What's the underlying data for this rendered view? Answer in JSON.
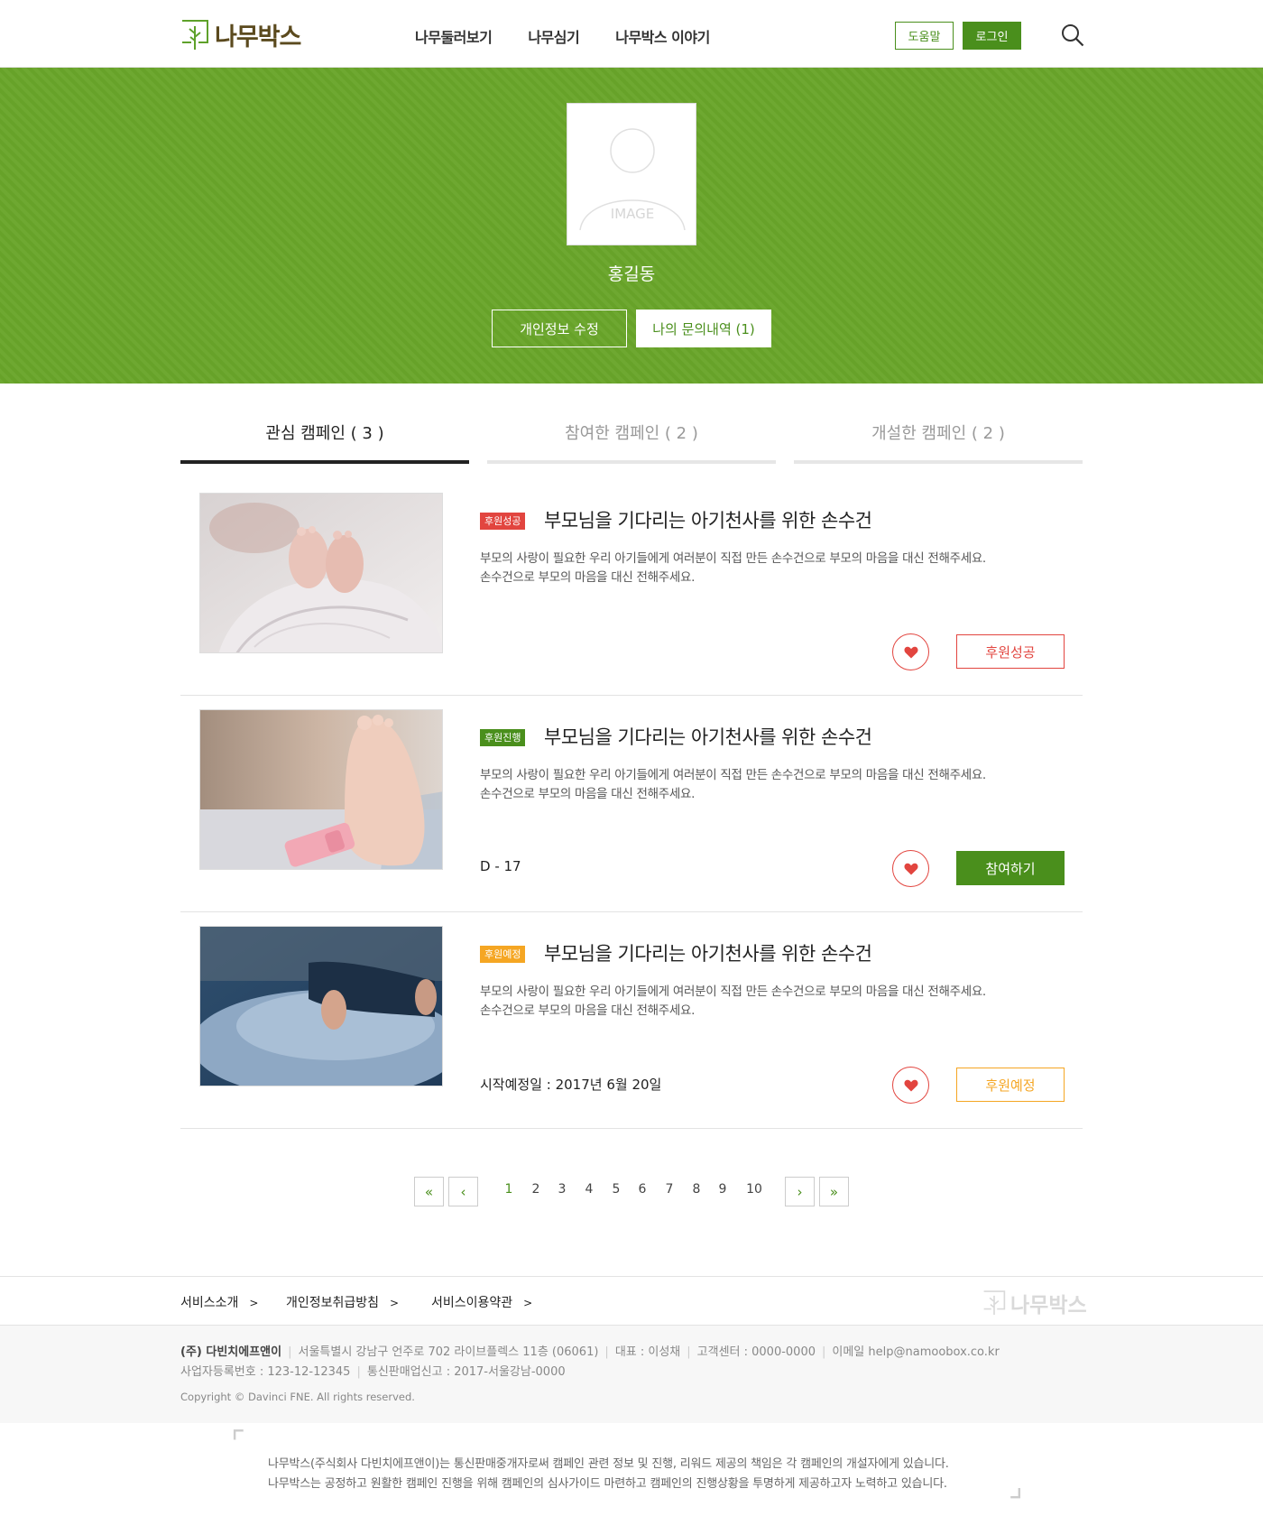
{
  "header": {
    "logo_text": "나무박스",
    "nav": [
      "나무둘러보기",
      "나무심기",
      "나무박스 이야기"
    ],
    "help_label": "도움말",
    "login_label": "로그인"
  },
  "profile": {
    "avatar_placeholder": "IMAGE",
    "name": "홍길동",
    "edit_label": "개인정보 수정",
    "inquiry_label": "나의 문의내역 (1)",
    "banner_color": "#69a52a"
  },
  "tabs": [
    {
      "label": "관심 캠페인 ( 3 )",
      "active": true
    },
    {
      "label": "참여한 캠페인 ( 2 )",
      "active": false
    },
    {
      "label": "개설한 캠페인 ( 2 )",
      "active": false
    }
  ],
  "campaigns": [
    {
      "badge": "후원성공",
      "title": "부모님을 기다리는 아기천사를 위한 손수건",
      "desc1": "부모의 사랑이 필요한 우리 아기들에게 여러분이 직접 만든 손수건으로 부모의 마음을 대신 전해주세요.",
      "desc2": "손수건으로 부모의 마음을 대신 전해주세요.",
      "meta": "",
      "action": "후원성공"
    },
    {
      "badge": "후원진행",
      "title": "부모님을 기다리는 아기천사를 위한 손수건",
      "desc1": "부모의 사랑이 필요한 우리 아기들에게 여러분이 직접 만든 손수건으로 부모의 마음을 대신 전해주세요.",
      "desc2": "손수건으로 부모의 마음을 대신 전해주세요.",
      "meta": "D - 17",
      "action": "참여하기"
    },
    {
      "badge": "후원예정",
      "title": "부모님을 기다리는 아기천사를 위한 손수건",
      "desc1": "부모의 사랑이 필요한 우리 아기들에게 여러분이 직접 만든 손수건으로 부모의 마음을 대신 전해주세요.",
      "desc2": "손수건으로 부모의 마음을 대신 전해주세요.",
      "meta": "시작예정일 : 2017년 6월 20일",
      "action": "후원예정"
    }
  ],
  "pagination": {
    "first": "«",
    "prev": "‹",
    "pages": [
      "1",
      "2",
      "3",
      "4",
      "5",
      "6",
      "7",
      "8",
      "9",
      "10"
    ],
    "current": "1",
    "next": "›",
    "last": "»"
  },
  "footer": {
    "links": [
      "서비스소개",
      "개인정보취급방침",
      "서비스이용약관"
    ],
    "logo_text": "나무박스",
    "company": "(주) 다빈치에프앤이",
    "address": "서울특별시 강남구 언주로 702 라이브플렉스 11층 (06061)",
    "ceo": "대표 : 이성채",
    "cs": "고객센터 : 0000-0000",
    "email": "이메일 help@namoobox.co.kr",
    "biz_no": "사업자등록번호 : 123-12-12345",
    "mail_order": "통신판매업신고 : 2017-서울강남-0000",
    "copyright": "Copyright © Davinci FNE. All rights reserved.",
    "notice1": "나무박스(주식회사 다빈치에프앤이)는 통신판매중개자로써 캠페인 관련 정보 및 진행, 리워드 제공의 책임은 각 캠페인의 개설자에게 있습니다.",
    "notice2": "나무박스는 공정하고 원활한 캠페인 진행을 위해 캠페인의 심사가이드 마련하고 캠페인의 진행상황을 투명하게 제공하고자 노력하고 있습니다."
  },
  "colors": {
    "brand_green": "#4a8f1c",
    "success_red": "#e2453f",
    "planned_orange": "#f5a623"
  }
}
